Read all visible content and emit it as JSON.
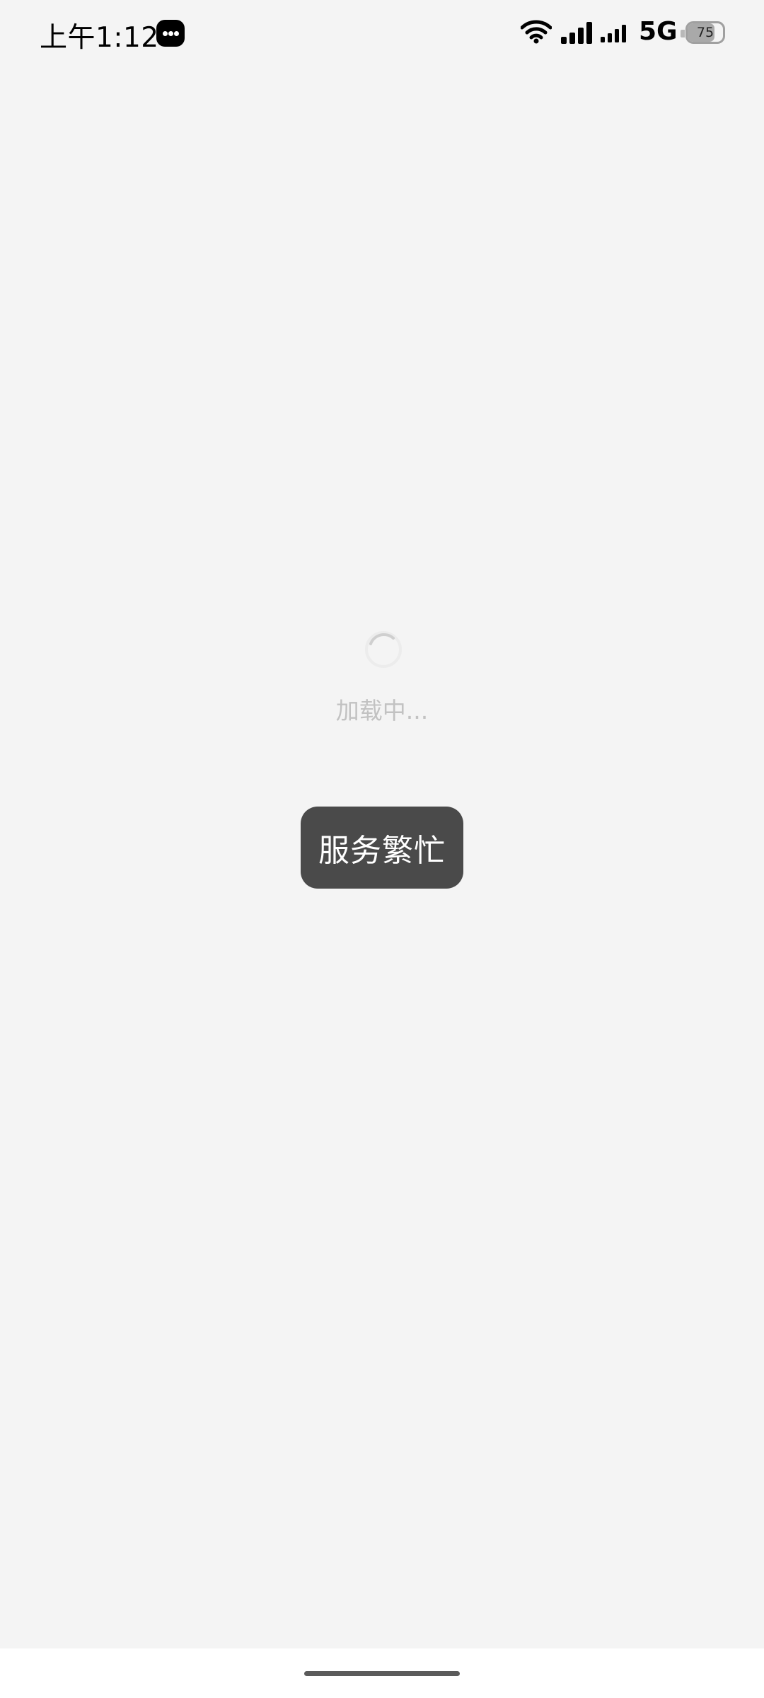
{
  "status_bar": {
    "time": "上午1:12",
    "network_type": "5G",
    "battery_level": "75",
    "battery_fraction": 0.75,
    "notification_icon": "chat-bubble-icon",
    "wifi_icon": "wifi-icon",
    "signal_icons": [
      "cellular-signal-icon",
      "cellular-signal-icon"
    ]
  },
  "loading": {
    "text": "加载中...",
    "icon": "spinner-icon"
  },
  "toast": {
    "text": "服务繁忙"
  },
  "colors": {
    "background": "#f4f4f4",
    "toast_background": "#4a4a4a",
    "loading_text": "#c2c2c2",
    "bottom_bar": "#ffffff"
  }
}
